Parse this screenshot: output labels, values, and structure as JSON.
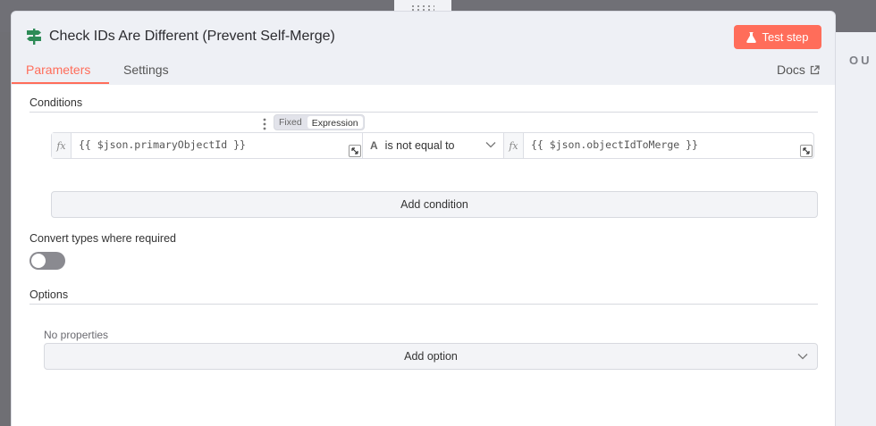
{
  "node": {
    "title": "Check IDs Are Different (Prevent Self-Merge)",
    "test_step_label": "Test step",
    "icon": "signpost-icon",
    "accent": "#ff6d5a"
  },
  "tabs": [
    {
      "label": "Parameters",
      "active": true
    },
    {
      "label": "Settings",
      "active": false
    }
  ],
  "docs_label": "Docs",
  "output_panel_label": "OU",
  "conditions": {
    "label": "Conditions",
    "mode_options": [
      "Fixed",
      "Expression"
    ],
    "mode_selected": "Expression",
    "row": {
      "left_value": "{{ $json.primaryObjectId }}",
      "operator": "is not equal to",
      "operator_type_icon": "A",
      "right_value": "{{ $json.objectIdToMerge }}"
    },
    "add_condition_label": "Add condition"
  },
  "convert_types": {
    "label": "Convert types where required",
    "enabled": false
  },
  "options": {
    "label": "Options",
    "empty_text": "No properties",
    "add_option_label": "Add option"
  }
}
